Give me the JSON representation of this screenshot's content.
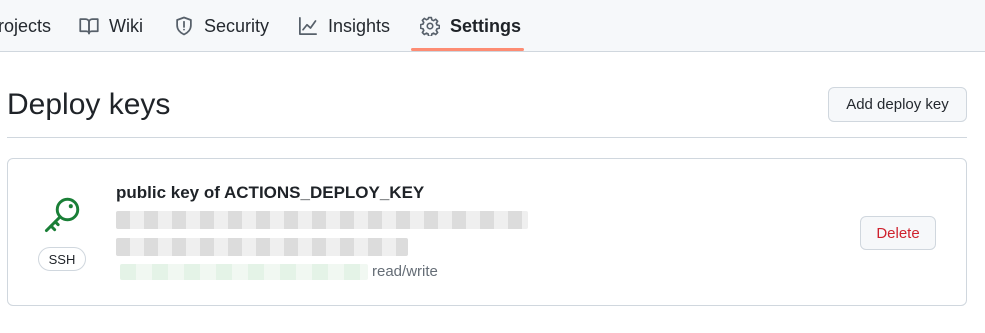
{
  "nav": {
    "items": [
      {
        "label": "rojects",
        "icon": "project-icon"
      },
      {
        "label": "Wiki",
        "icon": "book-icon"
      },
      {
        "label": "Security",
        "icon": "shield-icon"
      },
      {
        "label": "Insights",
        "icon": "graph-icon"
      },
      {
        "label": "Settings",
        "icon": "gear-icon",
        "active": true
      }
    ]
  },
  "page": {
    "title": "Deploy keys",
    "add_button_label": "Add deploy key"
  },
  "deploy_keys": [
    {
      "title": "public key of ACTIONS_DEPLOY_KEY",
      "type_badge": "SSH",
      "access": "read/write",
      "delete_label": "Delete"
    }
  ],
  "colors": {
    "accent_underline": "#fd8c73",
    "key_icon": "#1a7f37",
    "danger": "#cf222e"
  }
}
